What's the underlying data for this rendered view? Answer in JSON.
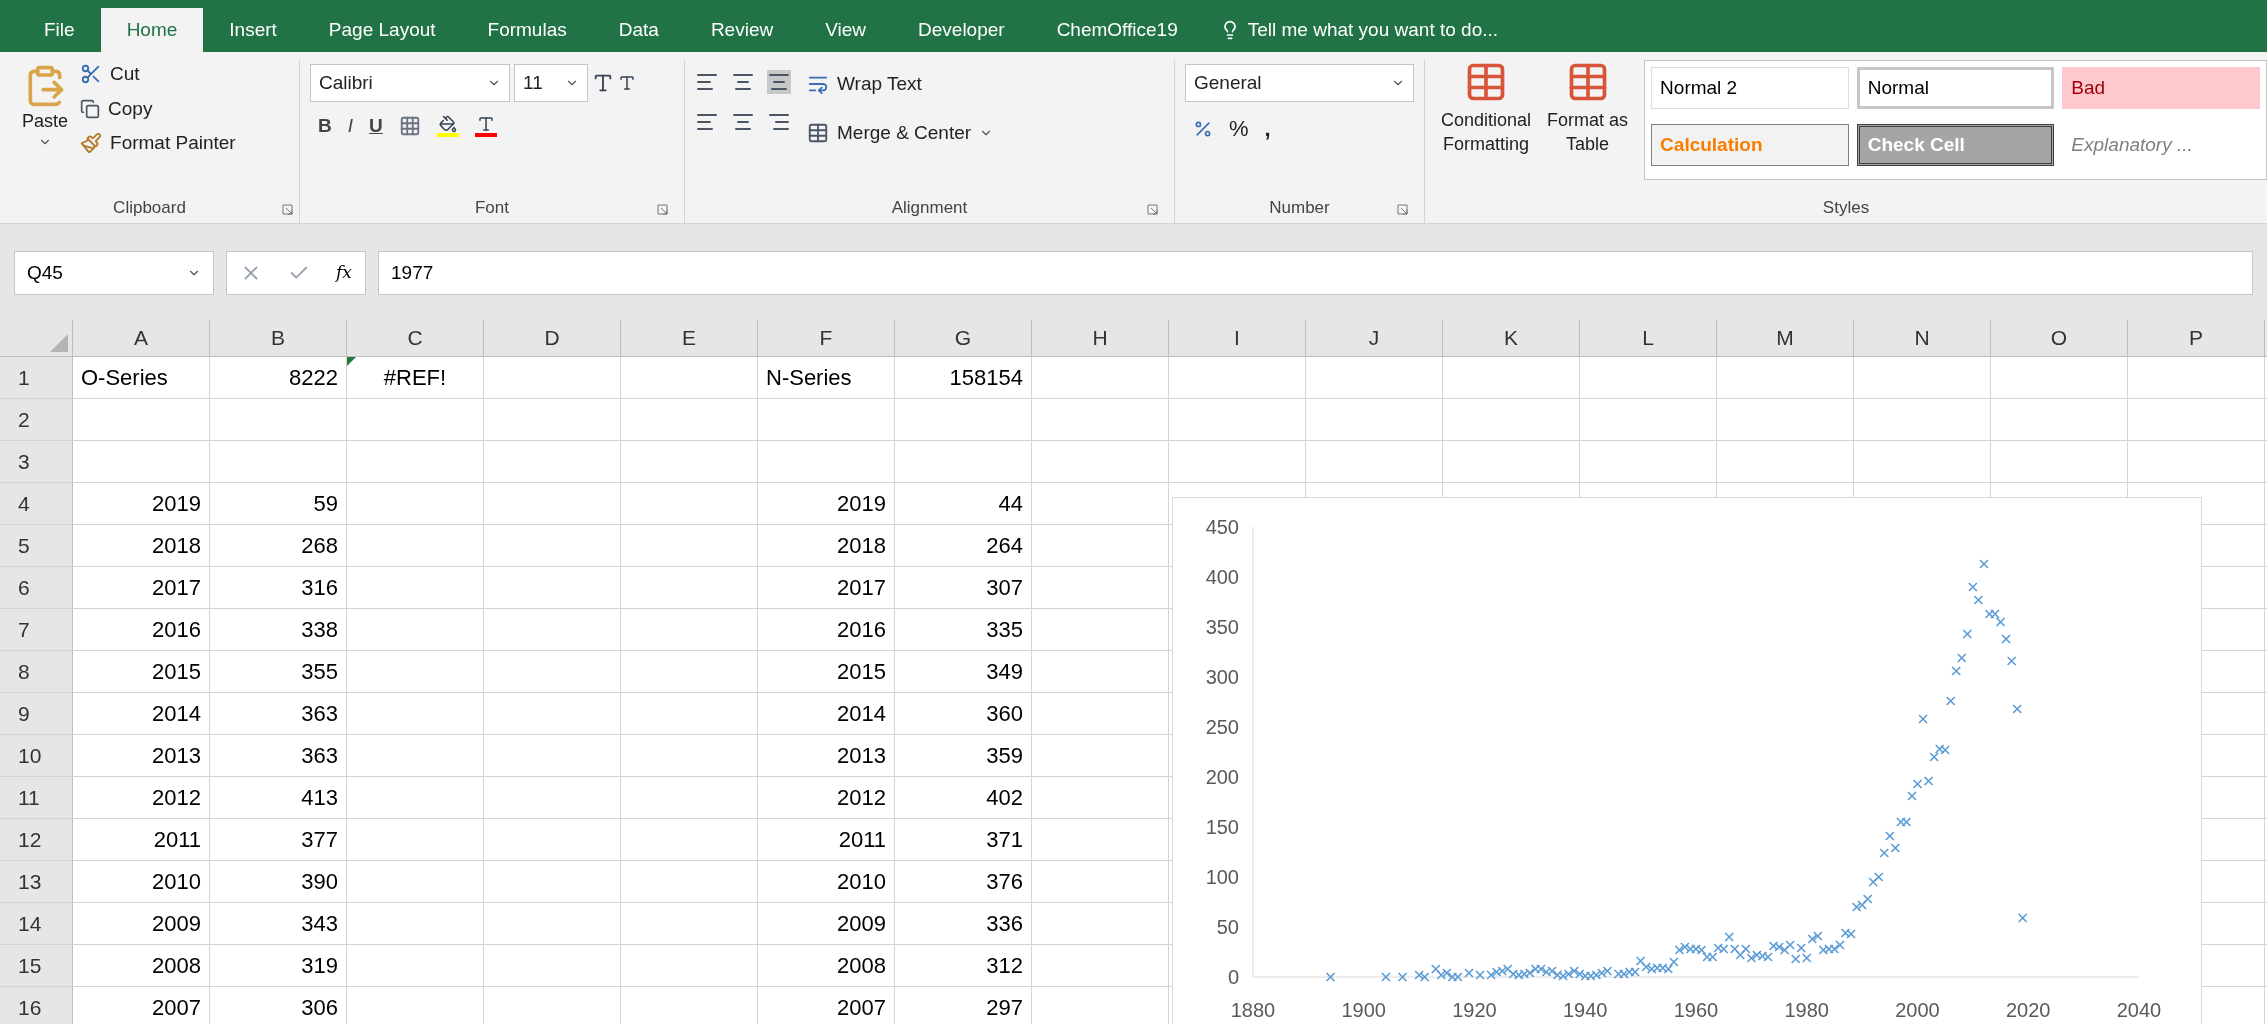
{
  "tabs": [
    {
      "label": "File",
      "selected": false
    },
    {
      "label": "Home",
      "selected": true
    },
    {
      "label": "Insert",
      "selected": false
    },
    {
      "label": "Page Layout",
      "selected": false
    },
    {
      "label": "Formulas",
      "selected": false
    },
    {
      "label": "Data",
      "selected": false
    },
    {
      "label": "Review",
      "selected": false
    },
    {
      "label": "View",
      "selected": false
    },
    {
      "label": "Developer",
      "selected": false
    },
    {
      "label": "ChemOffice19",
      "selected": false
    }
  ],
  "tell_me": "Tell me what you want to do...",
  "clipboard": {
    "paste": "Paste",
    "cut": "Cut",
    "copy": "Copy",
    "format_painter": "Format Painter",
    "label": "Clipboard"
  },
  "font": {
    "name": "Calibri",
    "size": "11",
    "bold": "B",
    "italic": "I",
    "underline": "U",
    "label": "Font"
  },
  "alignment": {
    "wrap_text": "Wrap Text",
    "merge": "Merge & Center",
    "label": "Alignment"
  },
  "number": {
    "format": "General",
    "percent": "%",
    "comma": ",",
    "label": "Number"
  },
  "styles": {
    "conditional": [
      "Conditional",
      "Formatting"
    ],
    "format_table": [
      "Format as",
      "Table"
    ],
    "label": "Styles",
    "cells": [
      {
        "label": "Normal 2",
        "kind": "plain"
      },
      {
        "label": "Normal",
        "kind": "normal"
      },
      {
        "label": "Bad",
        "kind": "bad"
      },
      {
        "label": "Calculation",
        "kind": "calculation"
      },
      {
        "label": "Check Cell",
        "kind": "check"
      },
      {
        "label": "Explanatory ...",
        "kind": "explanatory"
      }
    ]
  },
  "formula_bar": {
    "name_box": "Q45",
    "fx": "fx",
    "value": "1977"
  },
  "sheet": {
    "columns": [
      "A",
      "B",
      "C",
      "D",
      "E",
      "F",
      "G",
      "H",
      "I",
      "J",
      "K",
      "L",
      "M",
      "N",
      "O",
      "P"
    ],
    "rows": [
      {
        "header": "1",
        "cells": [
          {
            "text": "O-Series",
            "kind": "text"
          },
          {
            "text": "8222",
            "kind": "number"
          },
          {
            "text": "#REF!",
            "kind": "error"
          },
          {
            "text": ""
          },
          {
            "text": ""
          },
          {
            "text": "N-Series",
            "kind": "text"
          },
          {
            "text": "158154",
            "kind": "number"
          }
        ]
      },
      {
        "header": "2",
        "cells": []
      },
      {
        "header": "3",
        "cells": []
      },
      {
        "header": "4",
        "cells": [
          {
            "text": "2019",
            "kind": "number"
          },
          {
            "text": "59",
            "kind": "number"
          },
          {
            "text": ""
          },
          {
            "text": ""
          },
          {
            "text": ""
          },
          {
            "text": "2019",
            "kind": "number"
          },
          {
            "text": "44",
            "kind": "number"
          }
        ]
      },
      {
        "header": "5",
        "cells": [
          {
            "text": "2018",
            "kind": "number"
          },
          {
            "text": "268",
            "kind": "number"
          },
          {
            "text": ""
          },
          {
            "text": ""
          },
          {
            "text": ""
          },
          {
            "text": "2018",
            "kind": "number"
          },
          {
            "text": "264",
            "kind": "number"
          }
        ]
      },
      {
        "header": "6",
        "cells": [
          {
            "text": "2017",
            "kind": "number"
          },
          {
            "text": "316",
            "kind": "number"
          },
          {
            "text": ""
          },
          {
            "text": ""
          },
          {
            "text": ""
          },
          {
            "text": "2017",
            "kind": "number"
          },
          {
            "text": "307",
            "kind": "number"
          }
        ]
      },
      {
        "header": "7",
        "cells": [
          {
            "text": "2016",
            "kind": "number"
          },
          {
            "text": "338",
            "kind": "number"
          },
          {
            "text": ""
          },
          {
            "text": ""
          },
          {
            "text": ""
          },
          {
            "text": "2016",
            "kind": "number"
          },
          {
            "text": "335",
            "kind": "number"
          }
        ]
      },
      {
        "header": "8",
        "cells": [
          {
            "text": "2015",
            "kind": "number"
          },
          {
            "text": "355",
            "kind": "number"
          },
          {
            "text": ""
          },
          {
            "text": ""
          },
          {
            "text": ""
          },
          {
            "text": "2015",
            "kind": "number"
          },
          {
            "text": "349",
            "kind": "number"
          }
        ]
      },
      {
        "header": "9",
        "cells": [
          {
            "text": "2014",
            "kind": "number"
          },
          {
            "text": "363",
            "kind": "number"
          },
          {
            "text": ""
          },
          {
            "text": ""
          },
          {
            "text": ""
          },
          {
            "text": "2014",
            "kind": "number"
          },
          {
            "text": "360",
            "kind": "number"
          }
        ]
      },
      {
        "header": "10",
        "cells": [
          {
            "text": "2013",
            "kind": "number"
          },
          {
            "text": "363",
            "kind": "number"
          },
          {
            "text": ""
          },
          {
            "text": ""
          },
          {
            "text": ""
          },
          {
            "text": "2013",
            "kind": "number"
          },
          {
            "text": "359",
            "kind": "number"
          }
        ]
      },
      {
        "header": "11",
        "cells": [
          {
            "text": "2012",
            "kind": "number"
          },
          {
            "text": "413",
            "kind": "number"
          },
          {
            "text": ""
          },
          {
            "text": ""
          },
          {
            "text": ""
          },
          {
            "text": "2012",
            "kind": "number"
          },
          {
            "text": "402",
            "kind": "number"
          }
        ]
      },
      {
        "header": "12",
        "cells": [
          {
            "text": "2011",
            "kind": "number"
          },
          {
            "text": "377",
            "kind": "number"
          },
          {
            "text": ""
          },
          {
            "text": ""
          },
          {
            "text": ""
          },
          {
            "text": "2011",
            "kind": "number"
          },
          {
            "text": "371",
            "kind": "number"
          }
        ]
      },
      {
        "header": "13",
        "cells": [
          {
            "text": "2010",
            "kind": "number"
          },
          {
            "text": "390",
            "kind": "number"
          },
          {
            "text": ""
          },
          {
            "text": ""
          },
          {
            "text": ""
          },
          {
            "text": "2010",
            "kind": "number"
          },
          {
            "text": "376",
            "kind": "number"
          }
        ]
      },
      {
        "header": "14",
        "cells": [
          {
            "text": "2009",
            "kind": "number"
          },
          {
            "text": "343",
            "kind": "number"
          },
          {
            "text": ""
          },
          {
            "text": ""
          },
          {
            "text": ""
          },
          {
            "text": "2009",
            "kind": "number"
          },
          {
            "text": "336",
            "kind": "number"
          }
        ]
      },
      {
        "header": "15",
        "cells": [
          {
            "text": "2008",
            "kind": "number"
          },
          {
            "text": "319",
            "kind": "number"
          },
          {
            "text": ""
          },
          {
            "text": ""
          },
          {
            "text": ""
          },
          {
            "text": "2008",
            "kind": "number"
          },
          {
            "text": "312",
            "kind": "number"
          }
        ]
      },
      {
        "header": "16",
        "cells": [
          {
            "text": "2007",
            "kind": "number"
          },
          {
            "text": "306",
            "kind": "number"
          },
          {
            "text": ""
          },
          {
            "text": ""
          },
          {
            "text": ""
          },
          {
            "text": "2007",
            "kind": "number"
          },
          {
            "text": "297",
            "kind": "number"
          }
        ]
      }
    ]
  },
  "chart": {
    "chart_data": {
      "type": "scatter",
      "xlim": [
        1880,
        2040
      ],
      "ylim": [
        0,
        450
      ],
      "xticks": [
        1880,
        1900,
        1920,
        1940,
        1960,
        1980,
        2000,
        2020,
        2040
      ],
      "yticks": [
        0,
        50,
        100,
        150,
        200,
        250,
        300,
        350,
        400,
        450
      ],
      "x": [
        1894,
        1904,
        1907,
        1910,
        1911,
        1913,
        1914,
        1915,
        1916,
        1917,
        1919,
        1921,
        1923,
        1924,
        1925,
        1926,
        1927,
        1928,
        1929,
        1930,
        1931,
        1932,
        1933,
        1934,
        1935,
        1936,
        1937,
        1938,
        1939,
        1940,
        1941,
        1942,
        1943,
        1944,
        1946,
        1947,
        1948,
        1949,
        1950,
        1951,
        1952,
        1953,
        1954,
        1955,
        1956,
        1957,
        1958,
        1959,
        1960,
        1961,
        1962,
        1963,
        1964,
        1965,
        1966,
        1967,
        1968,
        1969,
        1970,
        1971,
        1972,
        1973,
        1974,
        1975,
        1976,
        1977,
        1978,
        1979,
        1980,
        1981,
        1982,
        1983,
        1984,
        1985,
        1986,
        1987,
        1988,
        1989,
        1990,
        1991,
        1992,
        1993,
        1994,
        1995,
        1996,
        1997,
        1998,
        1999,
        2000,
        2001,
        2002,
        2003,
        2004,
        2005,
        2006,
        2007,
        2008,
        2009,
        2010,
        2011,
        2012,
        2013,
        2014,
        2015,
        2016,
        2017,
        2018,
        2019
      ],
      "series": [
        {
          "color": "#5b9bd5",
          "values": [
            0,
            0,
            0,
            2,
            0,
            8,
            2,
            4,
            0,
            0,
            4,
            2,
            2,
            5,
            6,
            8,
            3,
            2,
            3,
            4,
            8,
            8,
            5,
            6,
            2,
            1,
            3,
            6,
            3,
            1,
            1,
            2,
            4,
            6,
            3,
            3,
            5,
            5,
            16,
            10,
            8,
            9,
            9,
            8,
            15,
            27,
            30,
            28,
            28,
            27,
            20,
            20,
            29,
            28,
            40,
            28,
            22,
            28,
            19,
            22,
            21,
            20,
            31,
            30,
            27,
            32,
            18,
            29,
            19,
            38,
            41,
            27,
            28,
            28,
            32,
            44,
            43,
            70,
            72,
            78,
            95,
            100,
            124,
            141,
            129,
            155,
            155,
            181,
            193,
            258,
            196,
            220,
            228,
            227,
            276,
            306,
            319,
            343,
            390,
            377,
            413,
            363,
            363,
            355,
            338,
            316,
            268,
            59
          ]
        }
      ]
    }
  }
}
